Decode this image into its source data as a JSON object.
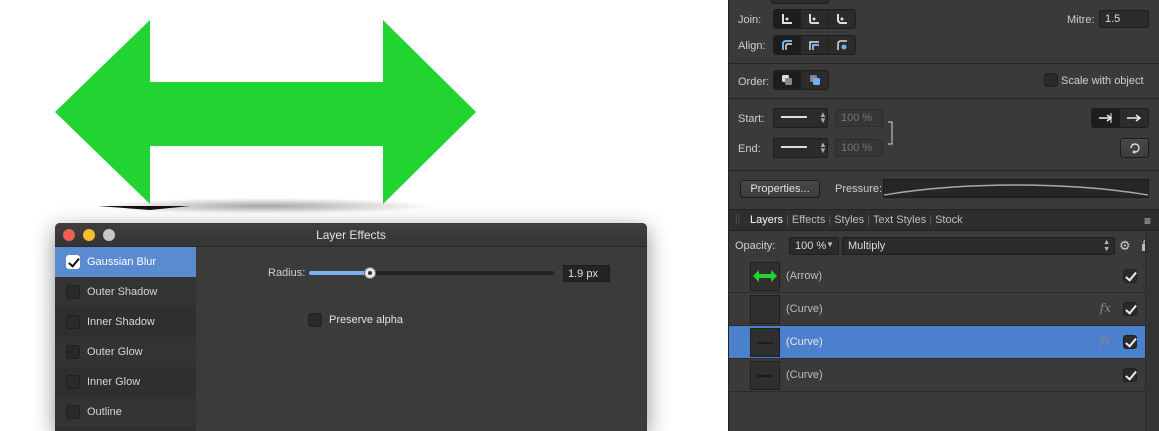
{
  "dialog": {
    "title": "Layer Effects",
    "effects": [
      {
        "label": "Gaussian Blur",
        "checked": true,
        "selected": true
      },
      {
        "label": "Outer Shadow",
        "checked": false,
        "selected": false
      },
      {
        "label": "Inner Shadow",
        "checked": false,
        "selected": false
      },
      {
        "label": "Outer Glow",
        "checked": false,
        "selected": false
      },
      {
        "label": "Inner Glow",
        "checked": false,
        "selected": false
      },
      {
        "label": "Outline",
        "checked": false,
        "selected": false
      }
    ],
    "radius_label": "Radius:",
    "radius_value": "1.9 px",
    "radius_fraction": 0.25,
    "preserve_alpha_label": "Preserve alpha"
  },
  "stroke": {
    "join_label": "Join:",
    "mitre_label": "Mitre:",
    "mitre_value": "1.5",
    "align_label": "Align:",
    "order_label": "Order:",
    "scale_label": "Scale with object",
    "start_label": "Start:",
    "end_label": "End:",
    "start_scale": "100 %",
    "end_scale": "100 %",
    "properties_button": "Properties...",
    "pressure_label": "Pressure:"
  },
  "layers_panel": {
    "tabs": [
      "Layers",
      "Effects",
      "Styles",
      "Text Styles",
      "Stock"
    ],
    "active_tab": "Layers",
    "opacity_label": "Opacity:",
    "opacity_value": "100 %",
    "blend_mode": "Multiply",
    "layers": [
      {
        "name": "(Arrow)",
        "fx": false,
        "selected": false
      },
      {
        "name": "(Curve)",
        "fx": true,
        "selected": false
      },
      {
        "name": "(Curve)",
        "fx": true,
        "selected": true
      },
      {
        "name": "(Curve)",
        "fx": false,
        "selected": false
      }
    ]
  },
  "colors": {
    "arrow_green": "#21d432",
    "selection_blue": "#4b80cc",
    "list_selection": "#5a8ad0"
  }
}
